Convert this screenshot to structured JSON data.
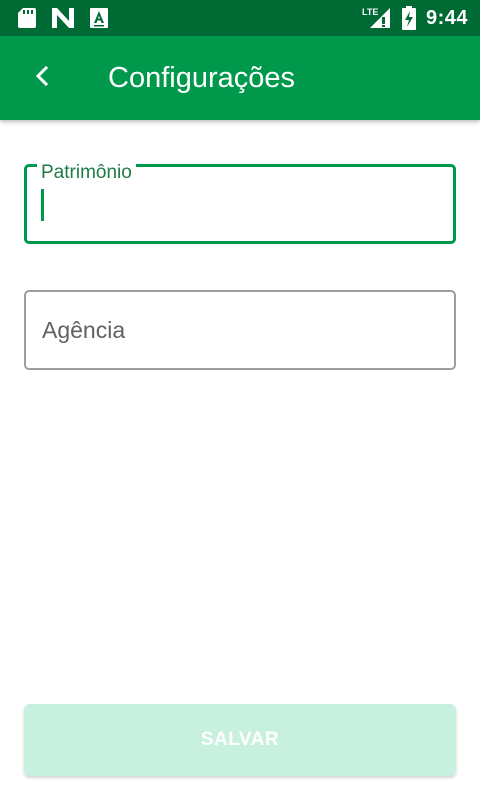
{
  "status_bar": {
    "time": "9:44",
    "network_label": "LTE",
    "icons": [
      "sd-card-icon",
      "n-logo-icon",
      "keyboard-a-icon",
      "lte-signal-icon",
      "battery-charging-icon"
    ]
  },
  "app_bar": {
    "title": "Configurações",
    "back_icon": "chevron-left-icon"
  },
  "form": {
    "patrimonio": {
      "label": "Patrimônio",
      "value": ""
    },
    "agencia": {
      "label": "Agência",
      "value": ""
    }
  },
  "actions": {
    "save_label": "SALVAR"
  },
  "colors": {
    "status_bar": "#006a35",
    "app_bar": "#00994c",
    "focused_border": "#00994c",
    "button_disabled_bg": "#c8f0df"
  }
}
